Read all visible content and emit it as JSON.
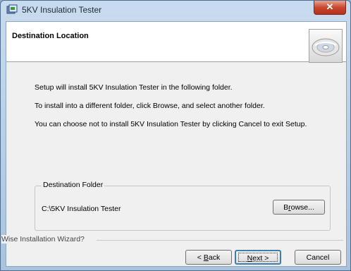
{
  "window": {
    "title": "5KV Insulation Tester",
    "close_glyph": "✕"
  },
  "header": {
    "title": "Destination Location",
    "image": "cd-disc-icon"
  },
  "body": {
    "line1": "Setup will install 5KV Insulation Tester in the following folder.",
    "line2": "To install into a different folder, click Browse, and select another folder.",
    "line3": "You can choose not to install 5KV Insulation Tester by clicking Cancel to exit Setup."
  },
  "destination": {
    "label": "Destination Folder",
    "path": "C:\\5KV Insulation Tester",
    "browse_first": "B",
    "browse_u": "r",
    "browse_rest": "owse..."
  },
  "footer": {
    "wizard_label": "Wise Installation Wizard?",
    "back_prefix": "< ",
    "back_u": "B",
    "back_rest": "ack",
    "next_u": "N",
    "next_rest": "ext >",
    "cancel": "Cancel"
  },
  "colors": {
    "titlebar": "#b9d1ea",
    "close": "#c9472f",
    "focus": "#3c7fb1"
  }
}
